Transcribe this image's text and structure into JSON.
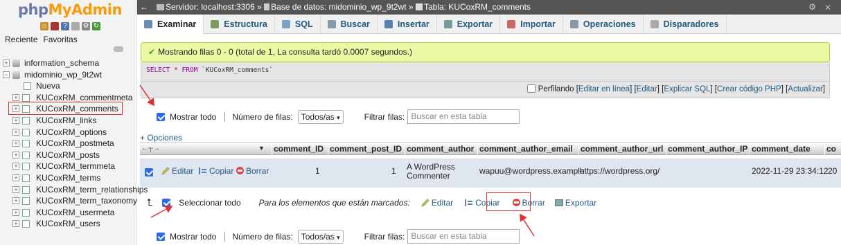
{
  "sidebar": {
    "logo_php": "php",
    "logo_ma": "MyAdmin",
    "tabs": [
      "Reciente",
      "Favoritas"
    ],
    "icons": [
      "home-icon",
      "exit-icon",
      "docs-icon",
      "sql-docs-icon",
      "settings-icon",
      "reload-icon"
    ],
    "tree": [
      {
        "label": "information_schema",
        "level": 0,
        "type": "db"
      },
      {
        "label": "midominio_wp_9t2wt",
        "level": 0,
        "type": "db"
      },
      {
        "label": "Nueva",
        "level": 1,
        "type": "new"
      },
      {
        "label": "KUCoxRM_commentmeta",
        "level": 1,
        "type": "table"
      },
      {
        "label": "KUCoxRM_comments",
        "level": 1,
        "type": "table"
      },
      {
        "label": "KUCoxRM_links",
        "level": 1,
        "type": "table"
      },
      {
        "label": "KUCoxRM_options",
        "level": 1,
        "type": "table"
      },
      {
        "label": "KUCoxRM_postmeta",
        "level": 1,
        "type": "table"
      },
      {
        "label": "KUCoxRM_posts",
        "level": 1,
        "type": "table"
      },
      {
        "label": "KUCoxRM_termmeta",
        "level": 1,
        "type": "table"
      },
      {
        "label": "KUCoxRM_terms",
        "level": 1,
        "type": "table"
      },
      {
        "label": "KUCoxRM_term_relationships",
        "level": 1,
        "type": "table"
      },
      {
        "label": "KUCoxRM_term_taxonomy",
        "level": 1,
        "type": "table"
      },
      {
        "label": "KUCoxRM_usermeta",
        "level": 1,
        "type": "table"
      },
      {
        "label": "KUCoxRM_users",
        "level": 1,
        "type": "table"
      }
    ]
  },
  "breadcrumb": {
    "server": "Servidor: localhost:3306",
    "sep1": "»",
    "database": "Base de datos: midominio_wp_9t2wt",
    "sep2": "»",
    "table": "Tabla: KUCoxRM_comments"
  },
  "menu": [
    {
      "label": "Examinar",
      "active": true,
      "icon": "browse-icon",
      "color": "#6a8bb5"
    },
    {
      "label": "Estructura",
      "active": false,
      "icon": "structure-icon",
      "color": "#7c9a5c"
    },
    {
      "label": "SQL",
      "active": false,
      "icon": "sql-icon",
      "color": "#7aa0c8"
    },
    {
      "label": "Buscar",
      "active": false,
      "icon": "search-icon",
      "color": "#8899aa"
    },
    {
      "label": "Insertar",
      "active": false,
      "icon": "insert-icon",
      "color": "#5a7fb0"
    },
    {
      "label": "Exportar",
      "active": false,
      "icon": "export-icon",
      "color": "#7a9a9a"
    },
    {
      "label": "Importar",
      "active": false,
      "icon": "import-icon",
      "color": "#c66"
    },
    {
      "label": "Operaciones",
      "active": false,
      "icon": "wrench-icon",
      "color": "#8899aa"
    },
    {
      "label": "Disparadores",
      "active": false,
      "icon": "triggers-icon",
      "color": "#aaa"
    }
  ],
  "message": "Mostrando filas 0 - 0 (total de 1, La consulta tardó 0.0007 segundos.)",
  "sql": {
    "select": "SELECT",
    "star": "*",
    "from": "FROM",
    "table": "`KUCoxRM_comments`"
  },
  "profiling": {
    "label": "Perfilando",
    "links": [
      "Editar en línea",
      "Editar",
      "Explicar SQL",
      "Crear código PHP",
      "Actualizar"
    ]
  },
  "controls": {
    "show_all": "Mostrar todo",
    "rows_label": "Número de filas:",
    "rows_value": "Todos/as",
    "filter_label": "Filtrar filas:",
    "filter_placeholder": "Buscar en esta tabla"
  },
  "options_link": "+ Opciones",
  "columns": [
    "comment_ID",
    "comment_post_ID",
    "comment_author",
    "comment_author_email",
    "comment_author_url",
    "comment_author_IP",
    "comment_date",
    "co"
  ],
  "row": {
    "edit": "Editar",
    "copy": "Copiar",
    "delete": "Borrar",
    "comment_ID": "1",
    "comment_post_ID": "1",
    "comment_author_1": "A WordPress",
    "comment_author_2": "Commenter",
    "comment_author_email": "wapuu@wordpress.example",
    "comment_author_url": "https://wordpress.org/",
    "comment_author_IP": "",
    "comment_date": "2022-11-29 23:34:12",
    "comment_date_gmt": "20"
  },
  "bulk": {
    "select_all": "Seleccionar todo",
    "with_selected": "Para los elementos que están marcados:",
    "edit": "Editar",
    "copy": "Copiar",
    "delete": "Borrar",
    "export": "Exportar"
  },
  "colors": {
    "success_bg": "#ebf8a4",
    "row_bg": "#dfe6ef",
    "link": "#235a81",
    "highlight": "#d33"
  }
}
